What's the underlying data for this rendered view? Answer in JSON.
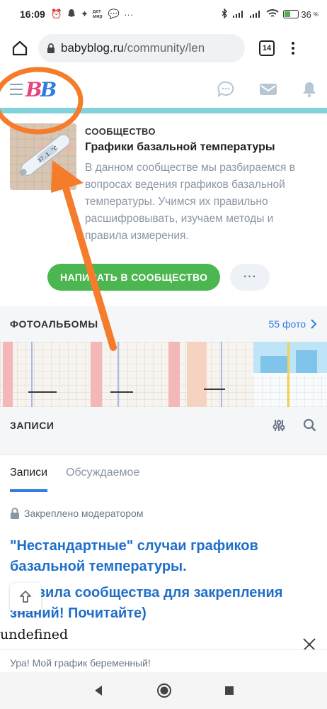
{
  "status_bar": {
    "time": "16:09",
    "notif_text": "дет мир",
    "battery": "36",
    "battery_level": 0.36,
    "battery_unit": "%"
  },
  "browser": {
    "url_domain": "babyblog.ru",
    "url_path": "/community/len",
    "tab_count": "14"
  },
  "site": {
    "logo": "BB"
  },
  "community": {
    "kicker": "СООБЩЕСТВО",
    "title": "Графики базальной температуры",
    "description": "В данном сообществе мы разбираемся в вопросах ведения графиков базальной температуры. Учимся их правильно расшифровывать, изучаем методы и правила измерения.",
    "image_label": "37.1 °C",
    "write_button": "НАПИСАТЬ В СООБЩЕСТВО",
    "more_button": "···"
  },
  "albums": {
    "label": "ФОТОАЛЬБОМЫ",
    "count": "55 фото"
  },
  "records": {
    "label": "ЗАПИСИ",
    "tabs": [
      "Записи",
      "Обсуждаемое"
    ],
    "pinned": "Закреплено модератором",
    "posts": [
      "\"Нестандартные\" случаи графиков базальной температуры.",
      "Правила сообщества для закрепления знаний! Почитайте)"
    ]
  },
  "overlay": {
    "undefined_text": "undefined",
    "banner_text": "Ура! Мой график беременный!"
  },
  "colors": {
    "accent_blue": "#2f7de1",
    "brand_pink": "#e8457f",
    "green_button": "#4cb650",
    "annotation_orange": "#f57c2a",
    "header_stripe": "#82d2db"
  }
}
